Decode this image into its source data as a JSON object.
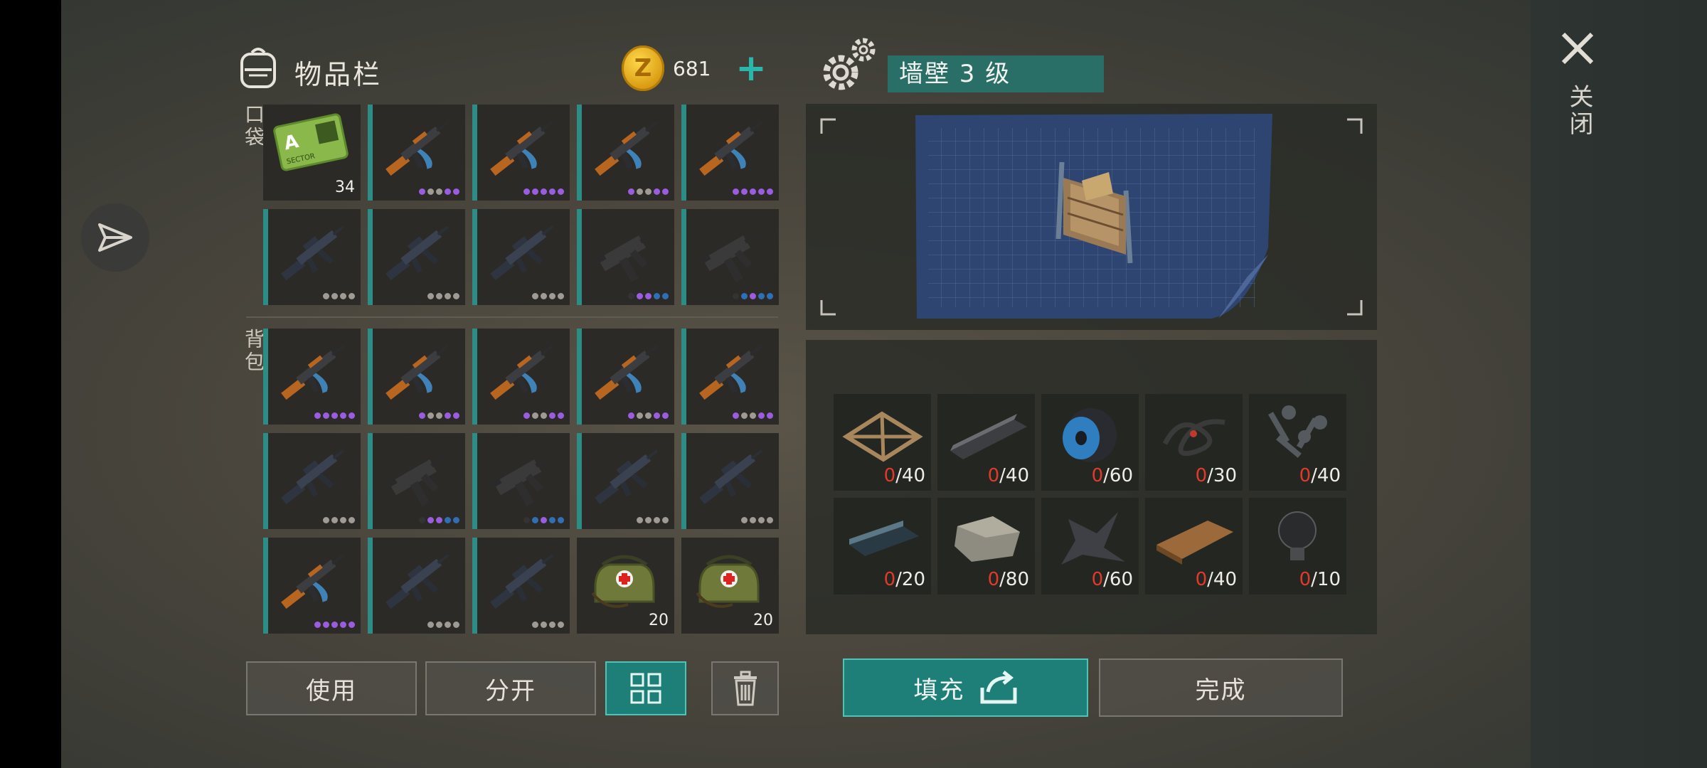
{
  "inventory": {
    "title": "物品栏",
    "coins": "681",
    "pocket_label": "口袋",
    "backpack_label": "背包",
    "pocket": [
      {
        "type": "card",
        "count": "34",
        "bar": false
      },
      {
        "type": "ak",
        "dots": [
          "#9a5de0",
          "#a09a94",
          "#a09a94",
          "#9a5de0",
          "#9a5de0"
        ],
        "bar": true
      },
      {
        "type": "ak",
        "dots": [
          "#9a5de0",
          "#9a5de0",
          "#9a5de0",
          "#9a5de0",
          "#9a5de0"
        ],
        "bar": true
      },
      {
        "type": "ak",
        "dots": [
          "#9a5de0",
          "#a09a94",
          "#a09a94",
          "#9a5de0",
          "#9a5de0"
        ],
        "bar": true
      },
      {
        "type": "ak",
        "dots": [
          "#9a5de0",
          "#9a5de0",
          "#9a5de0",
          "#9a5de0",
          "#9a5de0"
        ],
        "bar": true
      },
      {
        "type": "m16",
        "dots": [
          "#a09a94",
          "#a09a94",
          "#a09a94",
          "#a09a94"
        ],
        "bar": true
      },
      {
        "type": "m16",
        "dots": [
          "#a09a94",
          "#a09a94",
          "#a09a94",
          "#a09a94"
        ],
        "bar": true
      },
      {
        "type": "m16",
        "dots": [
          "#a09a94",
          "#a09a94",
          "#a09a94",
          "#a09a94"
        ],
        "bar": true
      },
      {
        "type": "uzi",
        "dots": [
          "#333",
          "#9a5de0",
          "#9a5de0",
          "#2f6fb5",
          "#2f6fb5"
        ],
        "bar": true
      },
      {
        "type": "uzi",
        "dots": [
          "#333",
          "#2f6fb5",
          "#9a5de0",
          "#2f6fb5",
          "#2f6fb5"
        ],
        "bar": true
      }
    ],
    "backpack": [
      {
        "type": "ak",
        "dots": [
          "#9a5de0",
          "#9a5de0",
          "#9a5de0",
          "#9a5de0",
          "#9a5de0"
        ],
        "bar": true
      },
      {
        "type": "ak",
        "dots": [
          "#9a5de0",
          "#a09a94",
          "#a09a94",
          "#9a5de0",
          "#9a5de0"
        ],
        "bar": true
      },
      {
        "type": "ak",
        "dots": [
          "#9a5de0",
          "#a09a94",
          "#a09a94",
          "#9a5de0",
          "#9a5de0"
        ],
        "bar": true
      },
      {
        "type": "ak",
        "dots": [
          "#9a5de0",
          "#a09a94",
          "#a09a94",
          "#9a5de0",
          "#9a5de0"
        ],
        "bar": true
      },
      {
        "type": "ak",
        "dots": [
          "#9a5de0",
          "#a09a94",
          "#a09a94",
          "#9a5de0",
          "#9a5de0"
        ],
        "bar": true
      },
      {
        "type": "m16",
        "dots": [
          "#a09a94",
          "#a09a94",
          "#a09a94",
          "#a09a94"
        ],
        "bar": true
      },
      {
        "type": "uzi",
        "dots": [
          "#333",
          "#9a5de0",
          "#9a5de0",
          "#2f6fb5",
          "#2f6fb5"
        ],
        "bar": true
      },
      {
        "type": "uzi",
        "dots": [
          "#333",
          "#2f6fb5",
          "#9a5de0",
          "#2f6fb5",
          "#2f6fb5"
        ],
        "bar": true
      },
      {
        "type": "m16",
        "dots": [
          "#a09a94",
          "#a09a94",
          "#a09a94",
          "#a09a94"
        ],
        "bar": true
      },
      {
        "type": "m16",
        "dots": [
          "#a09a94",
          "#a09a94",
          "#a09a94",
          "#a09a94"
        ],
        "bar": true
      },
      {
        "type": "ak",
        "dots": [
          "#9a5de0",
          "#9a5de0",
          "#9a5de0",
          "#9a5de0",
          "#9a5de0"
        ],
        "bar": true
      },
      {
        "type": "m16",
        "dots": [
          "#a09a94",
          "#a09a94",
          "#a09a94",
          "#a09a94"
        ],
        "bar": true
      },
      {
        "type": "m16",
        "dots": [
          "#a09a94",
          "#a09a94",
          "#a09a94",
          "#a09a94"
        ],
        "bar": true
      },
      {
        "type": "medkit",
        "count": "20",
        "bar": false
      },
      {
        "type": "medkit",
        "count": "20",
        "bar": false
      }
    ],
    "buttons": {
      "use": "使用",
      "split": "分开"
    }
  },
  "craft": {
    "title": "墙壁 3 级",
    "resources": [
      {
        "icon": "frame-icon",
        "have": "0",
        "need": "/40"
      },
      {
        "icon": "metal-bar-icon",
        "have": "0",
        "need": "/40"
      },
      {
        "icon": "wire-spool-icon",
        "have": "0",
        "need": "/60"
      },
      {
        "icon": "rope-icon",
        "have": "0",
        "need": "/30"
      },
      {
        "icon": "screws-icon",
        "have": "0",
        "need": "/40"
      },
      {
        "icon": "ingot-icon",
        "have": "0",
        "need": "/20"
      },
      {
        "icon": "stone-icon",
        "have": "0",
        "need": "/80"
      },
      {
        "icon": "scrap-metal-icon",
        "have": "0",
        "need": "/60"
      },
      {
        "icon": "plank-icon",
        "have": "0",
        "need": "/40"
      },
      {
        "icon": "light-bulb-icon",
        "have": "0",
        "need": "/10"
      }
    ],
    "fill_label": "填充",
    "done_label": "完成"
  },
  "close_label": "关闭",
  "colors": {
    "accent": "#1d7f78",
    "accent_border": "#4fc3b8",
    "missing": "#e03a2a"
  }
}
